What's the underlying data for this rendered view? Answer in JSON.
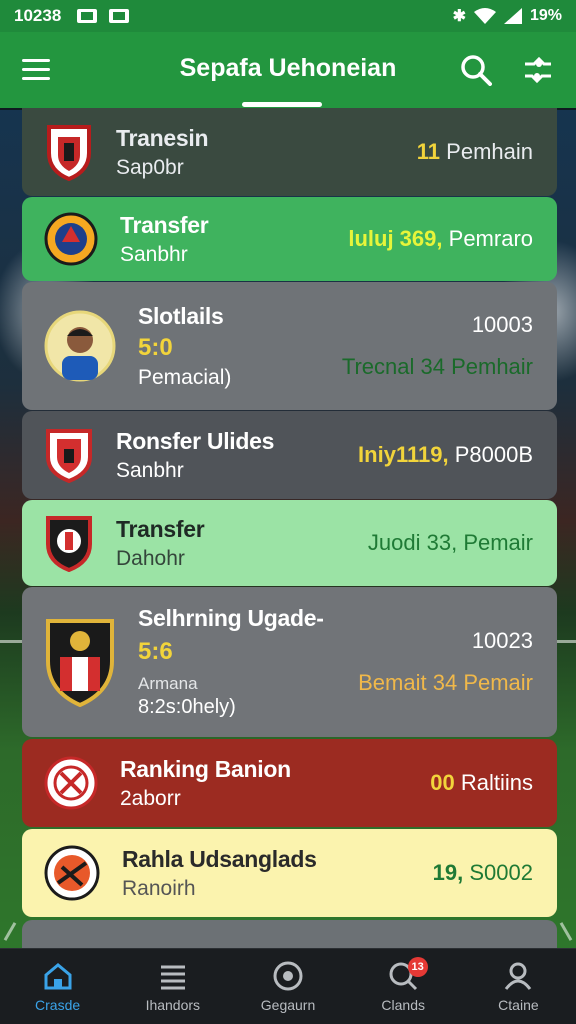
{
  "status": {
    "time": "10238",
    "battery": "19%"
  },
  "appbar": {
    "title": "Sepafa Uehoneian"
  },
  "cards": [
    {
      "name": "Tranesin",
      "sub": "Sap0br",
      "value": "11",
      "value_text": "Pemhain"
    },
    {
      "name": "Transfer",
      "sub": "Sanbhr",
      "value": "luluj 369,",
      "value_text": "Pemraro"
    },
    {
      "name": "Slotlails",
      "score": "5:0",
      "sub": "Pemacial)",
      "top_right": "10003",
      "value": "Trecnal 34",
      "value_text": "Pemhair"
    },
    {
      "name": "Ronsfer Ulides",
      "sub": "Sanbhr",
      "value": "Iniy1119,",
      "value_text": "P8000B"
    },
    {
      "name": "Transfer",
      "sub": "Dahohr",
      "value": "Juodi 33,",
      "value_text": "Pemair"
    },
    {
      "name": "Selhrning Ugade-",
      "score": "5:6",
      "sub": "Armana",
      "sub2": "8:2s:0hely)",
      "top_right": "10023",
      "value": "Bemait 34",
      "value_text": "Pemair"
    },
    {
      "name": "Ranking Banion",
      "sub": "2aborr",
      "value": "00",
      "value_text": "Raltiins"
    },
    {
      "name": "Rahla Udsanglads",
      "sub": "Ranoirh",
      "value": "19,",
      "value_text": "S0002"
    }
  ],
  "nav": [
    {
      "label": "Crasde",
      "icon": "home-icon"
    },
    {
      "label": "Ihandors",
      "icon": "list-icon"
    },
    {
      "label": "Gegaurn",
      "icon": "ball-icon"
    },
    {
      "label": "Clands",
      "icon": "search-icon",
      "badge": "13"
    },
    {
      "label": "Ctaine",
      "icon": "profile-icon"
    }
  ]
}
